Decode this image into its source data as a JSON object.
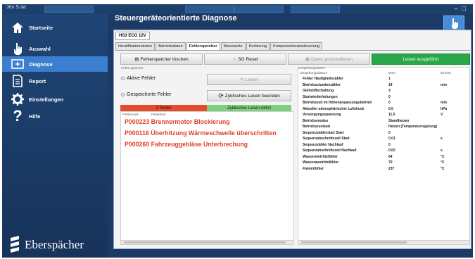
{
  "window": {
    "app_name": "Jeu S.aa",
    "title": "Steuergeräteorientierte Diagnose"
  },
  "sidebar": {
    "items": [
      {
        "label": "Startseite",
        "icon": "home-icon"
      },
      {
        "label": "Auswahl",
        "icon": "hand-pointer-icon"
      },
      {
        "label": "Diagnose",
        "icon": "diagnose-icon"
      },
      {
        "label": "Report",
        "icon": "document-icon"
      },
      {
        "label": "Einstellungen",
        "icon": "gear-icon"
      },
      {
        "label": "Hilfe",
        "icon": "help-icon"
      }
    ],
    "active_index": 2,
    "logo_text": "Eberspächer"
  },
  "device_tab": "HS3 ECO 12V",
  "tabs": [
    "Identifikationsdaten",
    "Betriebsdaten",
    "Fehlerspeicher",
    "Messwerte",
    "Kodierung",
    "Komponentenansteuerung"
  ],
  "active_tab": "Fehlerspeicher",
  "toolbar": {
    "clear_label": "Fehlerspeicher löschen",
    "reset_label": "SG Reset",
    "log_label": "Daten protokollieren",
    "status_label": "Lesen ausgeführt"
  },
  "fault_group": {
    "label": "Fehlerspeicher",
    "active_label": "Aktive Fehler",
    "stored_label": "Gespeicherte Fehler",
    "read_label": "Lesen",
    "cyclic_stop_label": "Zyklisches Lesen beenden",
    "count_label": "3 Fehler",
    "cyclic_status_label": "Zyklisches Lesen Aktiv!",
    "col_code": "Fehlercode",
    "col_text": "Fehlertext"
  },
  "faults": [
    "P000223 Brennermotor Blockierung",
    "P000116 Überhitzung Wärmeschwelle überschritten",
    "P000260 Fahrzeuggebläse Unterbrechung"
  ],
  "environment": {
    "title": "Umgebungsdaten",
    "col_name": "Umgebungsdatum",
    "col_value": "Wert",
    "col_unit": "Einheit",
    "rows": [
      {
        "name": "Fehler Häufigkeitszähler",
        "value": "1",
        "unit": ""
      },
      {
        "name": "Betriebsstundenzähler",
        "value": "14",
        "unit": "min"
      },
      {
        "name": "Glühstiftschaltung",
        "value": "3",
        "unit": ""
      },
      {
        "name": "Startwiederholungen",
        "value": "0",
        "unit": ""
      },
      {
        "name": "Betriebszeit im Höhenanpassungsbetrieb",
        "value": "0",
        "unit": "min"
      },
      {
        "name": "Aktueller atmosphärischer Luftdruck",
        "value": "0.0",
        "unit": "hPa"
      },
      {
        "name": "Versorgungsspannung",
        "value": "11.5",
        "unit": "V"
      },
      {
        "name": "Betriebsmodus",
        "value": "Standheizen",
        "unit": ""
      },
      {
        "name": "Betriebszustand",
        "value": "Heizen (Temperaturregelung)",
        "unit": ""
      },
      {
        "name": "Sequenzzählerstart Start",
        "value": "0",
        "unit": ""
      },
      {
        "name": "Sequenzabschnittszeit Start",
        "value": "0.01",
        "unit": "s"
      },
      {
        "name": "Sequenzzähler Nachlauf",
        "value": "0",
        "unit": ""
      },
      {
        "name": "Sequenzabschnittszeit Nachlauf",
        "value": "0.00",
        "unit": "s"
      },
      {
        "name": "Wassereintrittsfühler",
        "value": "64",
        "unit": "°C"
      },
      {
        "name": "Wasseraustrittsfühler",
        "value": "70",
        "unit": "°C"
      },
      {
        "name": "Flammfühler",
        "value": "237",
        "unit": "°C"
      }
    ]
  }
}
